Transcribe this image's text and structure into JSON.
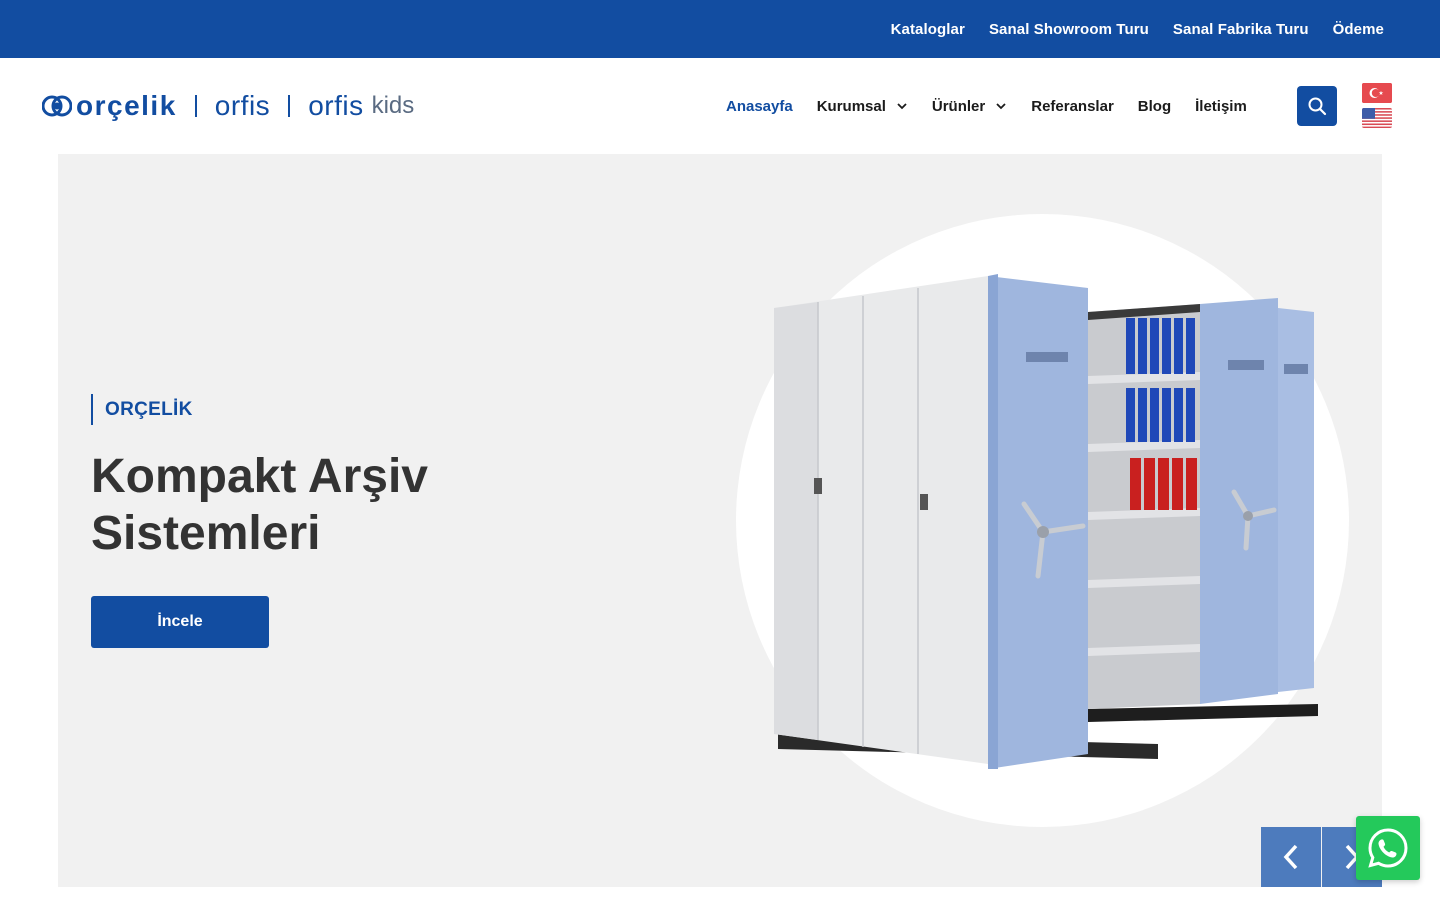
{
  "topbar": {
    "links": [
      "Kataloglar",
      "Sanal Showroom Turu",
      "Sanal Fabrika Turu",
      "Ödeme"
    ]
  },
  "header": {
    "logo": {
      "brand": "orçelik",
      "sub1": "orfis",
      "sub2": "orfis",
      "sub2_suffix": "kids"
    },
    "nav": {
      "home": "Anasayfa",
      "corporate": "Kurumsal",
      "products": "Ürünler",
      "references": "Referanslar",
      "blog": "Blog",
      "contact": "İletişim"
    },
    "languages": [
      "tr",
      "en-us"
    ]
  },
  "hero": {
    "tag": "ORÇELİK",
    "title": "Kompakt Arşiv Sistemleri",
    "cta": "İncele"
  },
  "colors": {
    "brand_blue": "#124da1",
    "hero_bg": "#f1f1f1",
    "slider_btn": "#4d7bbd",
    "whatsapp": "#24c95b"
  },
  "icons": {
    "search": "search-icon",
    "prev": "chevron-left-icon",
    "next": "chevron-right-icon",
    "whatsapp": "whatsapp-icon",
    "dropdown": "chevron-down-icon"
  }
}
